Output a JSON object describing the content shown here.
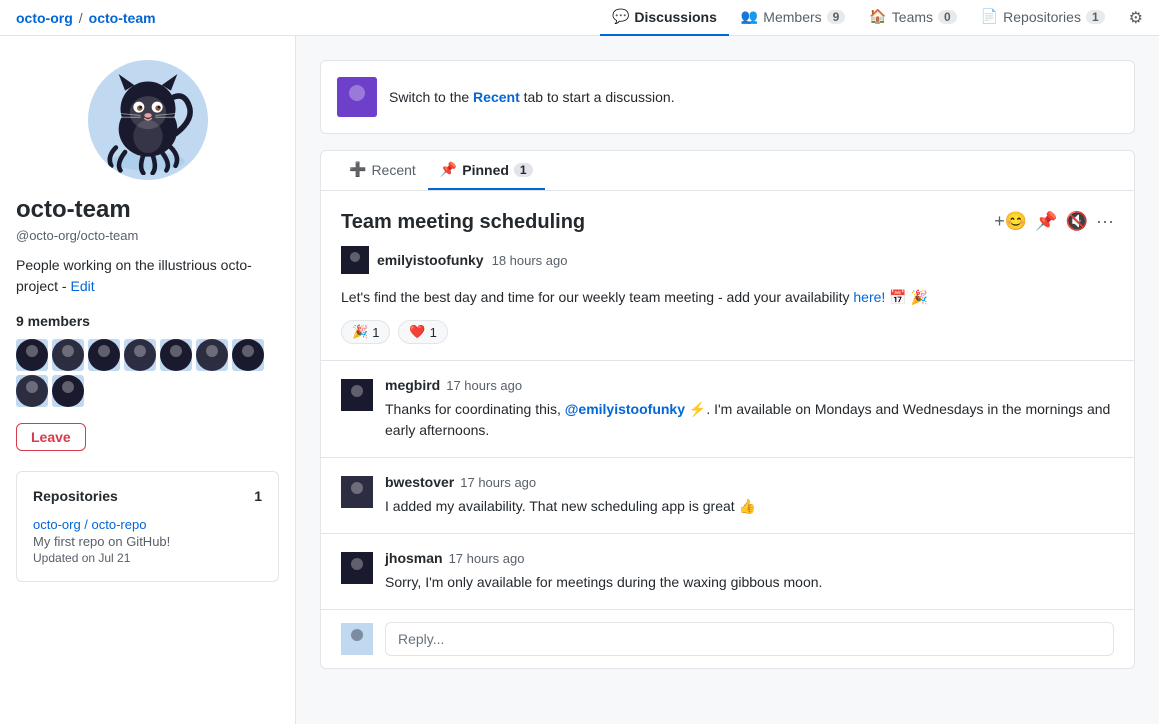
{
  "breadcrumb": {
    "org": "octo-org",
    "separator": "/",
    "team": "octo-team"
  },
  "nav": {
    "tabs": [
      {
        "id": "discussions",
        "label": "Discussions",
        "badge": null,
        "active": true
      },
      {
        "id": "members",
        "label": "Members",
        "badge": "9",
        "active": false
      },
      {
        "id": "teams",
        "label": "Teams",
        "badge": "0",
        "active": false
      },
      {
        "id": "repositories",
        "label": "Repositories",
        "badge": "1",
        "active": false
      }
    ]
  },
  "sidebar": {
    "team_name": "octo-team",
    "team_handle": "@octo-org/octo-team",
    "description": "People working on the illustrious octo-project",
    "edit_label": "Edit",
    "members_label": "9 members",
    "member_count": 9,
    "leave_button": "Leave",
    "repositories_section": {
      "title": "Repositories",
      "count": "1",
      "repo_link": "octo-org / octo-repo",
      "repo_desc": "My first repo on GitHub!",
      "repo_updated": "Updated on Jul 21"
    }
  },
  "banner": {
    "text_prefix": "Switch to the",
    "link_text": "Recent",
    "text_suffix": "tab to start a discussion."
  },
  "discussion_tabs": [
    {
      "id": "recent",
      "label": "Recent",
      "icon": "➕",
      "active": false
    },
    {
      "id": "pinned",
      "label": "Pinned",
      "icon": "📌",
      "count": "1",
      "active": true
    }
  ],
  "discussion": {
    "title": "Team meeting scheduling",
    "author": "emilyistoofunky",
    "time": "18 hours ago",
    "body": "Let's find the best day and time for our weekly team meeting - add your availability",
    "link_text": "here!",
    "emojis": "📅 🎉",
    "reactions": [
      {
        "emoji": "🎉",
        "count": "1"
      },
      {
        "emoji": "❤️",
        "count": "1"
      }
    ]
  },
  "comments": [
    {
      "author": "megbird",
      "time": "17 hours ago",
      "body_prefix": "Thanks for coordinating this,",
      "mention": "@emilyistoofunky",
      "body_suffix": "⚡. I'm available on Mondays and Wednesdays in the mornings and early afternoons."
    },
    {
      "author": "bwestover",
      "time": "17 hours ago",
      "body": "I added my availability. That new scheduling app is great 👍"
    },
    {
      "author": "jhosman",
      "time": "17 hours ago",
      "body": "Sorry, I'm only available for meetings during the waxing gibbous moon."
    }
  ],
  "reply": {
    "placeholder": "Reply..."
  },
  "colors": {
    "accent": "#0366d6",
    "danger": "#d73a49",
    "border": "#e1e4e8",
    "text_muted": "#586069"
  }
}
